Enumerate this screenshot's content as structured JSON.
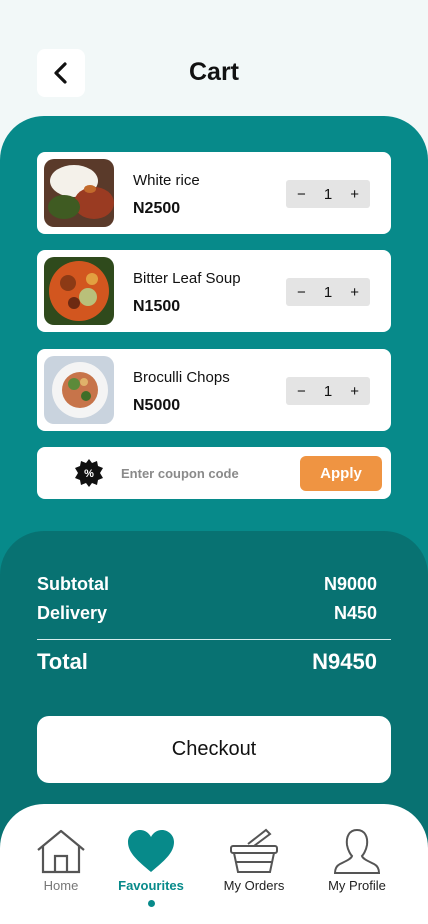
{
  "header": {
    "title": "Cart",
    "back_icon": "chevron-left-icon"
  },
  "cart": {
    "items": [
      {
        "name": "White rice",
        "price": "N2500",
        "qty": "1",
        "minus": "−",
        "plus": "+"
      },
      {
        "name": "Bitter Leaf Soup",
        "price": "N1500",
        "qty": "1",
        "minus": "−",
        "plus": "+"
      },
      {
        "name": "Broculli Chops",
        "price": "N5000",
        "qty": "1",
        "minus": "−",
        "plus": "+"
      }
    ]
  },
  "coupon": {
    "placeholder": "Enter coupon code",
    "apply_label": "Apply",
    "icon": "discount-badge-icon"
  },
  "summary": {
    "subtotal_label": "Subtotal",
    "subtotal_value": "N9000",
    "delivery_label": "Delivery",
    "delivery_value": "N450",
    "total_label": "Total",
    "total_value": "N9450",
    "checkout_label": "Checkout"
  },
  "nav": {
    "items": [
      {
        "label": "Home",
        "icon": "home-icon"
      },
      {
        "label": "Favourites",
        "icon": "heart-icon",
        "active": true
      },
      {
        "label": "My Orders",
        "icon": "basket-icon"
      },
      {
        "label": "My Profile",
        "icon": "person-icon"
      }
    ]
  },
  "colors": {
    "teal": "#078a8a",
    "dark_teal": "#087272",
    "accent": "#ef9442",
    "background": "#f2f8f8"
  }
}
